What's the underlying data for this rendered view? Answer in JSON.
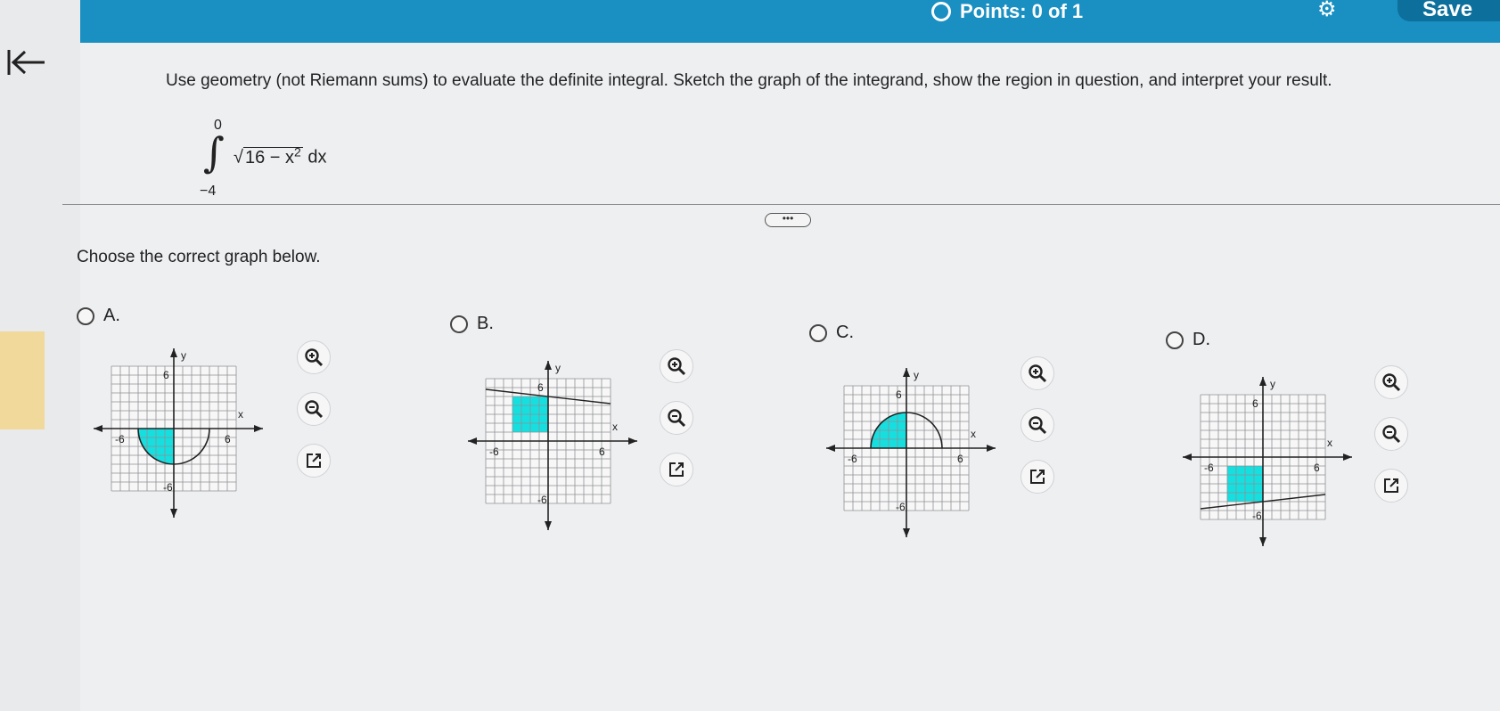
{
  "header": {
    "points_label": "Points: 0 of 1",
    "save_label": "Save"
  },
  "question": {
    "prompt": "Use geometry (not Riemann sums) to evaluate the definite integral. Sketch the graph of the integrand, show the region in question, and interpret your result.",
    "integral": {
      "upper": "0",
      "lower": "−4",
      "radicand": "16 − x",
      "exponent": "2",
      "differential": "dx"
    },
    "more_label": "•••",
    "instruction": "Choose the correct graph below."
  },
  "options": [
    {
      "letter": "A.",
      "y_label": "y",
      "x_label": "x",
      "x_min": "-6",
      "x_max": "6",
      "y_max": "6",
      "y_min": "-6"
    },
    {
      "letter": "B.",
      "y_label": "y",
      "x_label": "x",
      "x_min": "-6",
      "x_max": "6",
      "y_max": "6",
      "y_min": "-6"
    },
    {
      "letter": "C.",
      "y_label": "y",
      "x_label": "x",
      "x_min": "-6",
      "x_max": "6",
      "y_max": "6",
      "y_min": "-6"
    },
    {
      "letter": "D.",
      "y_label": "y",
      "x_label": "x",
      "x_min": "-6",
      "x_max": "6",
      "y_max": "6",
      "y_min": "-6"
    }
  ],
  "colors": {
    "header": "#1a8fc2",
    "shade": "#16dfe0"
  }
}
